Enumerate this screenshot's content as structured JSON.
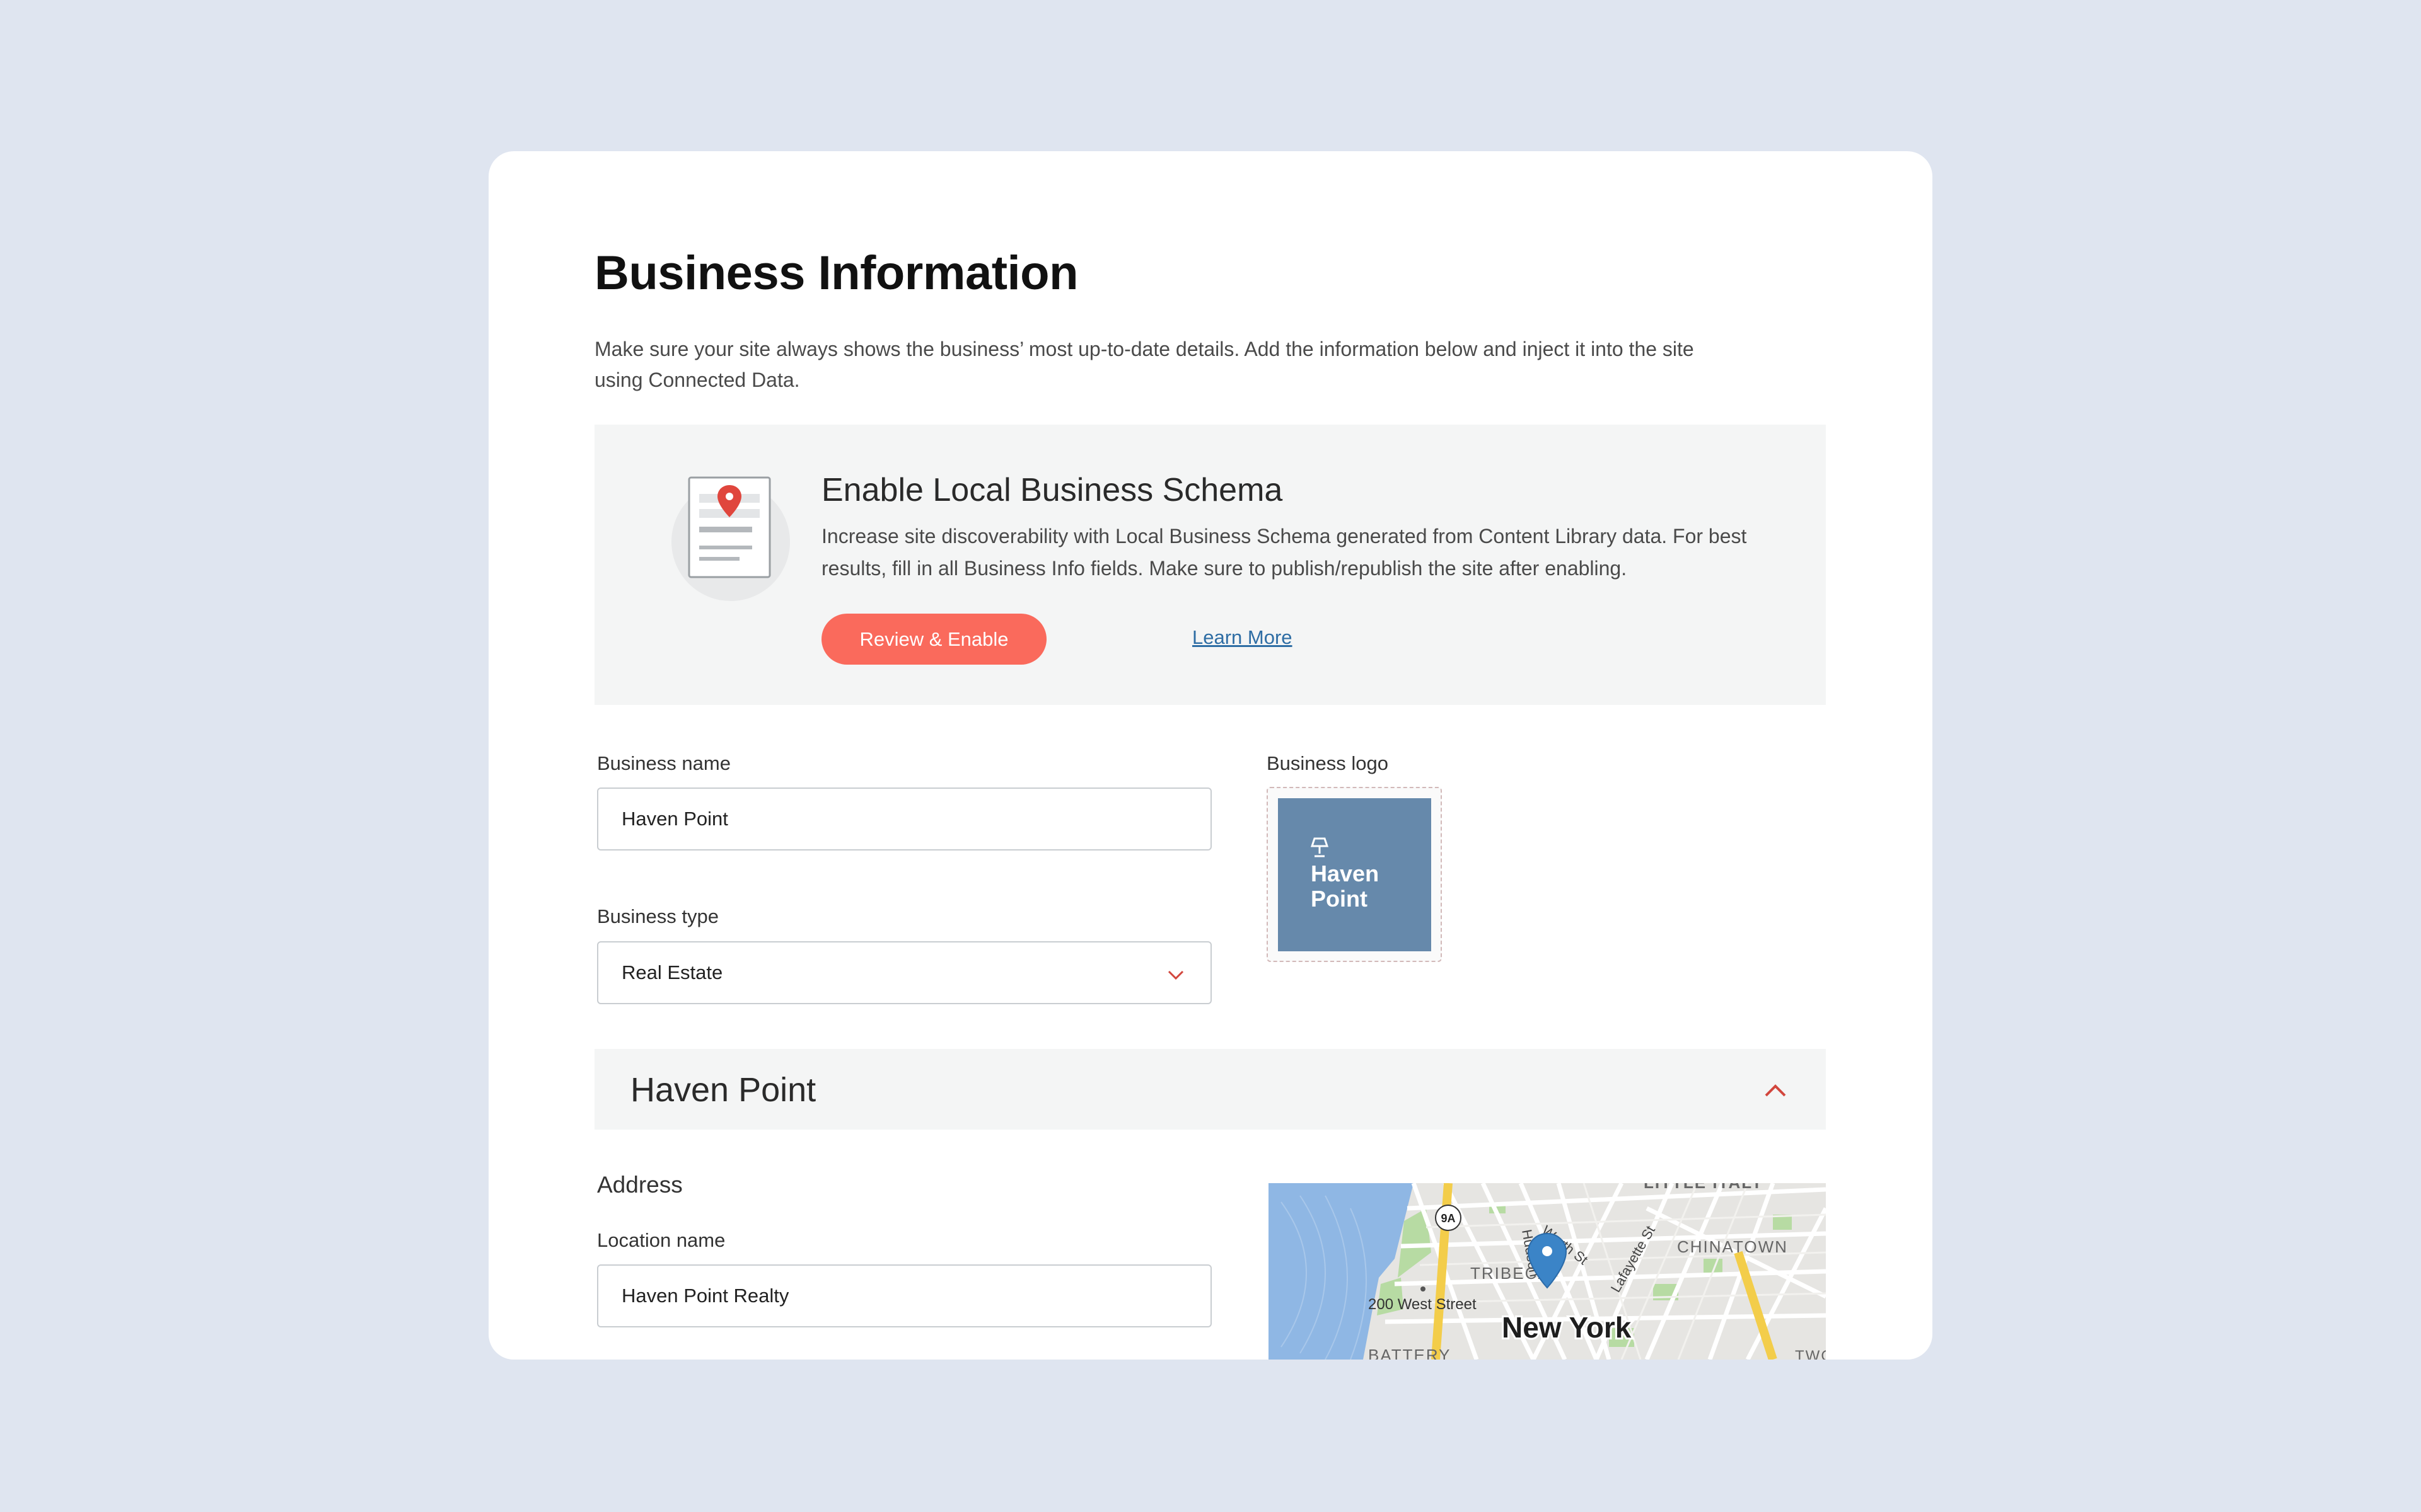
{
  "page": {
    "title": "Business Information",
    "description": "Make sure your site always shows the business’ most up-to-date details. Add the information below and inject it into the site using Connected Data."
  },
  "schema_banner": {
    "title": "Enable Local Business Schema",
    "text": "Increase site discoverability with Local Business Schema generated from Content Library data. For best results, fill in all Business Info fields. Make sure to publish/republish the site after enabling.",
    "primary_button": "Review & Enable",
    "link": "Learn More",
    "illustration_icon": "document-location-pin-icon"
  },
  "form": {
    "business_name": {
      "label": "Business name",
      "value": "Haven Point"
    },
    "business_type": {
      "label": "Business type",
      "value": "Real Estate"
    },
    "business_logo": {
      "label": "Business logo",
      "line1": "Haven",
      "line2": "Point",
      "icon": "lamp-icon"
    }
  },
  "location_section": {
    "title": "Haven Point",
    "expanded": true,
    "address_label": "Address",
    "location_name": {
      "label": "Location name",
      "value": "Haven Point Realty"
    }
  },
  "map": {
    "labels": {
      "city": "New York",
      "address": "200 West Street",
      "tribeca": "TRIBECA",
      "chinatown": "CHINATOWN",
      "little_italy": "LITTLE ITALY",
      "battery": "BATTERY",
      "two": "TWO",
      "hudson": "Hudson",
      "worth": "Worth St",
      "lafayette": "Lafayette St",
      "route": "9A"
    }
  },
  "colors": {
    "background": "#dfe5f0",
    "accent": "#fa6a5c",
    "link": "#2e6da4",
    "logo_tile": "#6689ab",
    "panel": "#f4f5f5"
  }
}
